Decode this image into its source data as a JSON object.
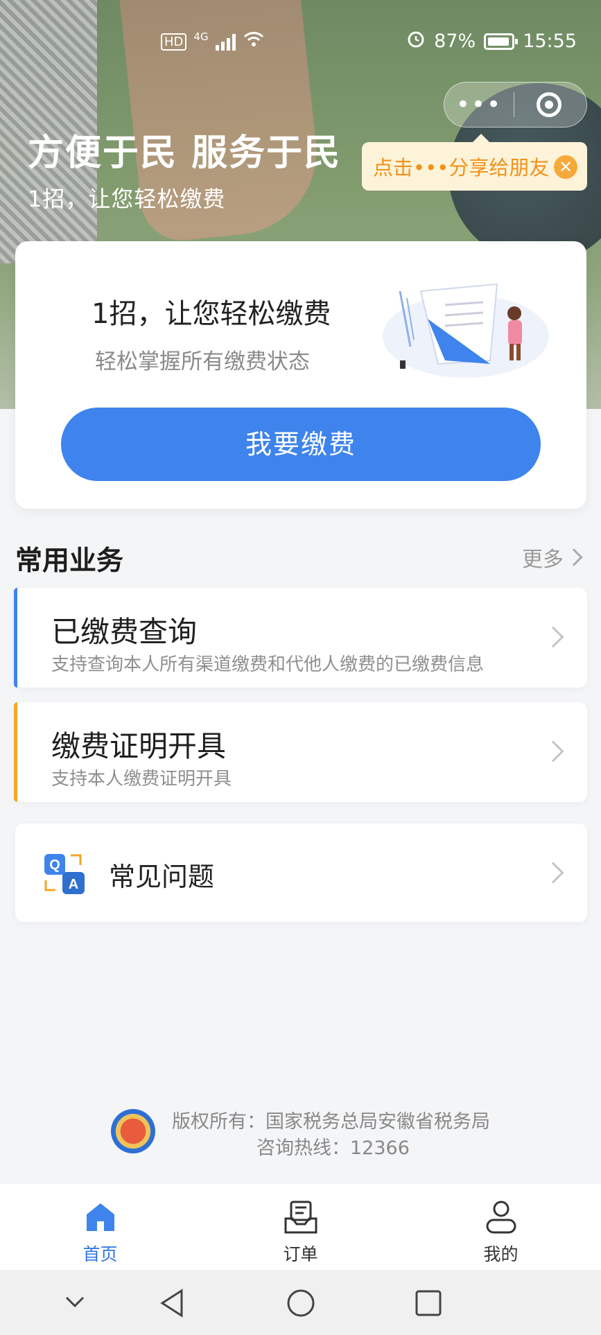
{
  "status_bar": {
    "network_tags": "HD",
    "net_type": "4G",
    "battery": "87%",
    "time": "15:55"
  },
  "capsule": {
    "more_icon": "more-dots-icon",
    "close_icon": "target-circle-icon"
  },
  "share_tip": {
    "text": "点击•••分享给朋友"
  },
  "hero": {
    "title": "方便于民 服务于民",
    "subtitle": "1招，让您轻松缴费"
  },
  "pay_card": {
    "title": "1招，让您轻松缴费",
    "subtitle": "轻松掌握所有缴费状态",
    "button": "我要缴费"
  },
  "common": {
    "title": "常用业务",
    "more": "更多",
    "items": [
      {
        "name": "已缴费查询",
        "desc": "支持查询本人所有渠道缴费和代他人缴费的已缴费信息",
        "accent": "#3e84ec"
      },
      {
        "name": "缴费证明开具",
        "desc": "支持本人缴费证明开具",
        "accent": "#f5a623"
      }
    ]
  },
  "faq": {
    "label": "常见问题"
  },
  "footer": {
    "copyright": "版权所有：国家税务总局安徽省税务局",
    "hotline": "咨询热线：12366"
  },
  "tabs": [
    {
      "label": "首页",
      "icon": "home-icon",
      "active": true
    },
    {
      "label": "订单",
      "icon": "order-icon",
      "active": false
    },
    {
      "label": "我的",
      "icon": "user-icon",
      "active": false
    }
  ],
  "colors": {
    "primary": "#3e84ec",
    "warning": "#f5a623"
  }
}
